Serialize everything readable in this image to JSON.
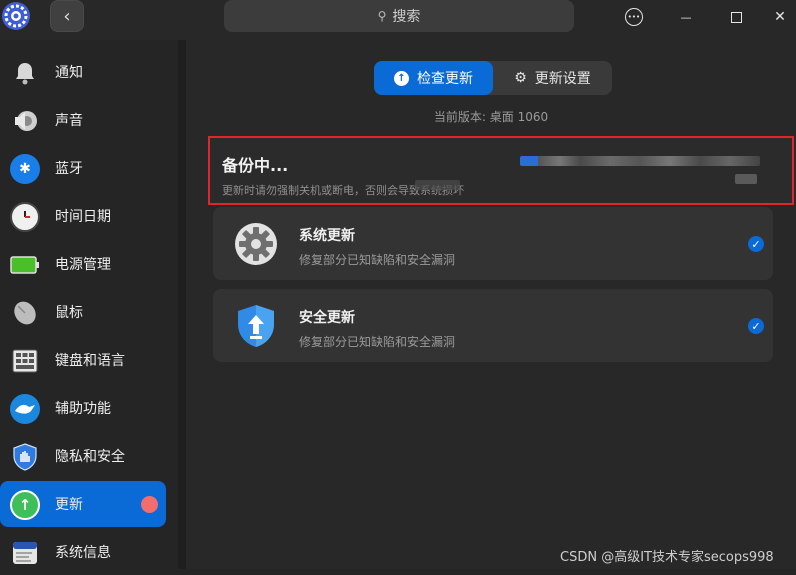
{
  "header": {
    "search_placeholder": "搜索",
    "back_glyph": "‹",
    "menu_glyph": "•••",
    "minimize_glyph": "—",
    "maximize_glyph": "☐",
    "close_glyph": "✕"
  },
  "sidebar": {
    "items": [
      {
        "label": "通知",
        "icon": "bell-icon"
      },
      {
        "label": "声音",
        "icon": "speaker-icon"
      },
      {
        "label": "蓝牙",
        "icon": "bluetooth-icon"
      },
      {
        "label": "时间日期",
        "icon": "clock-icon"
      },
      {
        "label": "电源管理",
        "icon": "battery-icon"
      },
      {
        "label": "鼠标",
        "icon": "mouse-icon"
      },
      {
        "label": "键盘和语言",
        "icon": "keyboard-icon"
      },
      {
        "label": "辅助功能",
        "icon": "accessibility-icon"
      },
      {
        "label": "隐私和安全",
        "icon": "privacy-shield-icon"
      },
      {
        "label": "更新",
        "icon": "update-icon",
        "active": true,
        "badge": "red-dot"
      },
      {
        "label": "系统信息",
        "icon": "system-info-icon"
      }
    ]
  },
  "main": {
    "tabs": [
      {
        "label": "检查更新",
        "active": true
      },
      {
        "label": "更新设置",
        "active": false
      }
    ],
    "version_text": "当前版本: 桌面 1060",
    "backup": {
      "title": "备份中...",
      "subtitle": "更新时请勿强制关机或断电，否则会导致系统损坏"
    },
    "updates": [
      {
        "title": "系统更新",
        "subtitle": "修复部分已知缺陷和安全漏洞",
        "icon": "gear-icon",
        "checked": true
      },
      {
        "title": "安全更新",
        "subtitle": "修复部分已知缺陷和安全漏洞",
        "icon": "security-shield-icon",
        "checked": true
      }
    ]
  },
  "watermark": "CSDN @高级IT技术专家secops998",
  "colors": {
    "accent": "#0a6ad6",
    "highlight_border": "#e0262b",
    "badge": "#f26d6d"
  }
}
